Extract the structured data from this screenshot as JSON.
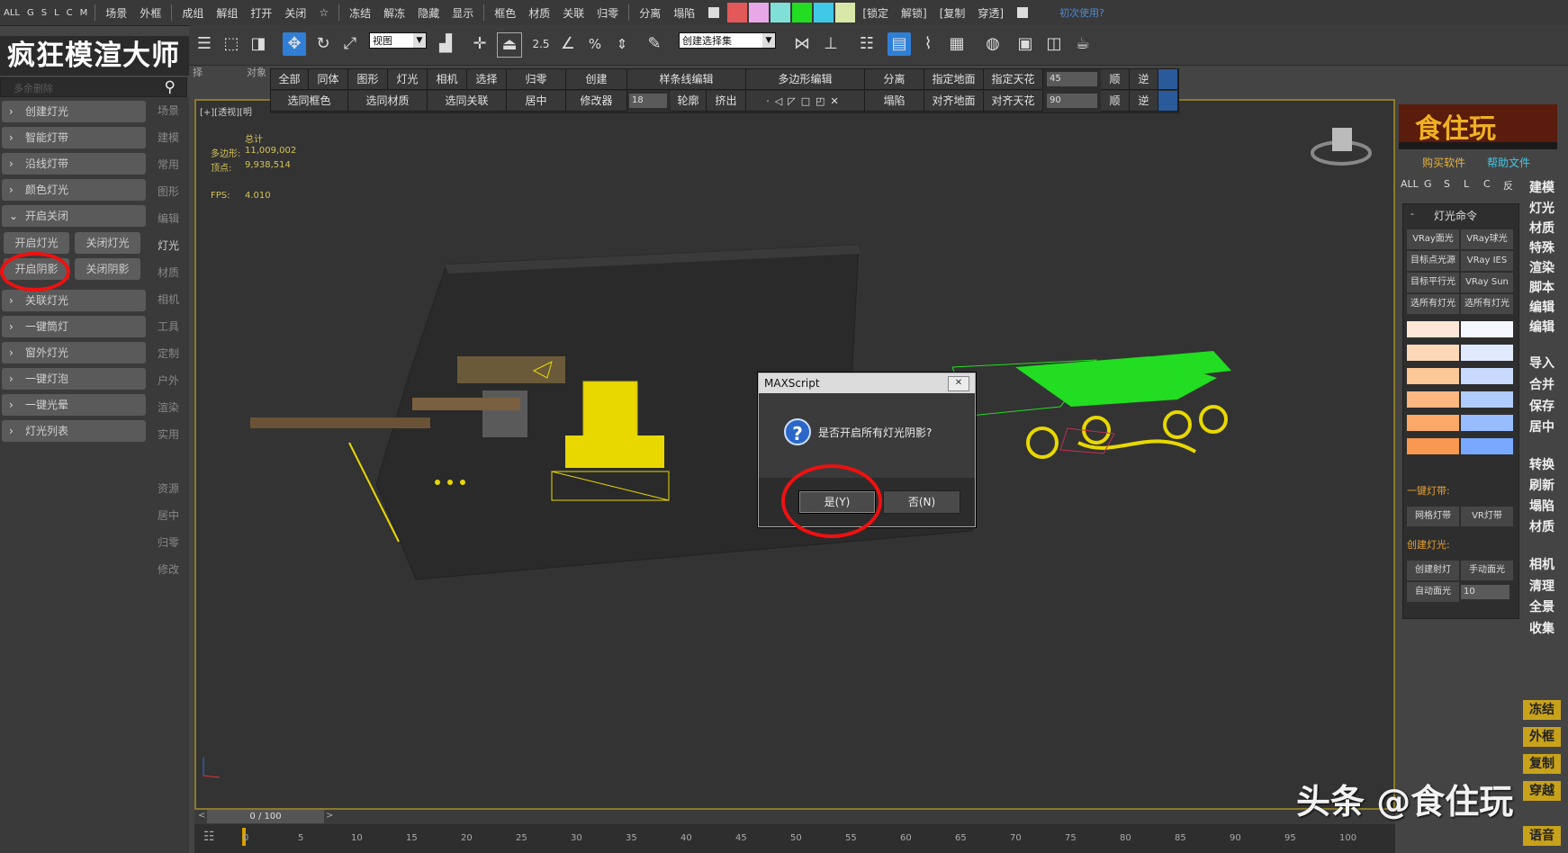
{
  "topbar": {
    "filters": [
      "ALL",
      "G",
      "S",
      "L",
      "C",
      "M"
    ],
    "items": [
      "场景",
      "外框",
      "成组",
      "解组",
      "打开",
      "关闭",
      "☆",
      "冻结",
      "解冻",
      "隐藏",
      "显示",
      "框色",
      "材质",
      "关联",
      "归零",
      "分离",
      "塌陷"
    ],
    "colors": [
      "#e35858",
      "#e8a8e8",
      "#80e0d8",
      "#22dd22",
      "#40c8e8",
      "#d8e8a8"
    ],
    "right_items": [
      "[锁定",
      "解锁]",
      "[复制",
      "穿透]"
    ],
    "first_use": "初次使用?"
  },
  "toolbar": {
    "view_select": "视图",
    "selection_set": "创建选择集",
    "snap_angle": "2.5"
  },
  "left": {
    "logo": "疯狂模渲大师",
    "search_placeholder": "多余删除",
    "buttons": [
      "创建灯光",
      "智能灯带",
      "沿线灯带",
      "颜色灯光",
      "开启关闭"
    ],
    "sub_buttons": [
      "开启灯光",
      "关闭灯光",
      "开启阴影",
      "关闭阴影"
    ],
    "buttons2": [
      "关联灯光",
      "一键筒灯",
      "窗外灯光",
      "一键灯泡",
      "一键光晕",
      "灯光列表"
    ],
    "side_tabs": [
      "场景",
      "建模",
      "常用",
      "图形",
      "编辑",
      "灯光",
      "材质",
      "相机",
      "工具",
      "定制",
      "户外",
      "渲染",
      "实用"
    ],
    "side_tabs2": [
      "资源",
      "居中",
      "归零",
      "修改"
    ],
    "row_labels": [
      "择",
      "对象"
    ]
  },
  "quick": {
    "row1": [
      "全部",
      "同体",
      "图形",
      "灯光",
      "相机",
      "选择",
      "归零",
      "创建",
      "样条线编辑",
      "多边形编辑",
      "分离",
      "指定地面",
      "指定天花"
    ],
    "row2": [
      "选同框色",
      "选同材质",
      "选同关联",
      "居中",
      "修改器",
      "轮廓",
      "挤出",
      "塌陷",
      "对齐地面",
      "对齐天花"
    ],
    "val1": "45",
    "val2": "90",
    "val3": "18",
    "shun": "顺",
    "ni": "逆"
  },
  "viewport": {
    "label": "[+][透视][明",
    "total_label": "总计",
    "poly_label": "多边形:",
    "poly_value": "11,009,002",
    "vert_label": "顶点:",
    "vert_value": "9,938,514",
    "fps_label": "FPS:",
    "fps_value": "4.010"
  },
  "dialog": {
    "title": "MAXScript",
    "close": "✕",
    "message": "是否开启所有灯光阴影?",
    "yes": "是(Y)",
    "no": "否(N)"
  },
  "right": {
    "ad_text": "食住玩",
    "buy": "购买软件",
    "help": "帮助文件",
    "nav": [
      "ALL",
      "G",
      "S",
      "L",
      "C",
      "反"
    ],
    "panel_title": "灯光命令",
    "light_buttons": [
      "VRay面光",
      "VRay球光",
      "目标点光源",
      "VRay IES",
      "目标平行光",
      "VRay Sun",
      "选所有灯光",
      "选所有灯光"
    ],
    "warm_colors": [
      "#fde8d8",
      "#fdd8b8",
      "#fcc898",
      "#fcb880",
      "#fba868",
      "#f99850"
    ],
    "cool_colors": [
      "#f6f8ff",
      "#e0eaff",
      "#c8dbff",
      "#b0ccff",
      "#98bcff",
      "#78a8ff"
    ],
    "strip_label": "一键灯带:",
    "strip_buttons": [
      "网格灯带",
      "VR灯带"
    ],
    "create_label": "创建灯光:",
    "create_buttons": [
      "创建射灯",
      "手动面光",
      "自动面光"
    ],
    "create_value": "10",
    "side": [
      "建模",
      "灯光",
      "材质",
      "特殊",
      "渲染",
      "脚本",
      "编辑",
      "编辑",
      "导入",
      "合并",
      "保存",
      "居中",
      "转换",
      "刷新",
      "塌陷",
      "材质",
      "相机",
      "清理",
      "全景",
      "收集"
    ],
    "side_bottom": [
      "冻结",
      "外框",
      "复制",
      "穿越",
      "语音"
    ]
  },
  "timeline": {
    "frame": "0 / 100",
    "ticks": [
      "0",
      "5",
      "10",
      "15",
      "20",
      "25",
      "30",
      "35",
      "40",
      "45",
      "50",
      "55",
      "60",
      "65",
      "70",
      "75",
      "80",
      "85",
      "90",
      "95",
      "100"
    ]
  },
  "watermark": "头条 @食住玩"
}
